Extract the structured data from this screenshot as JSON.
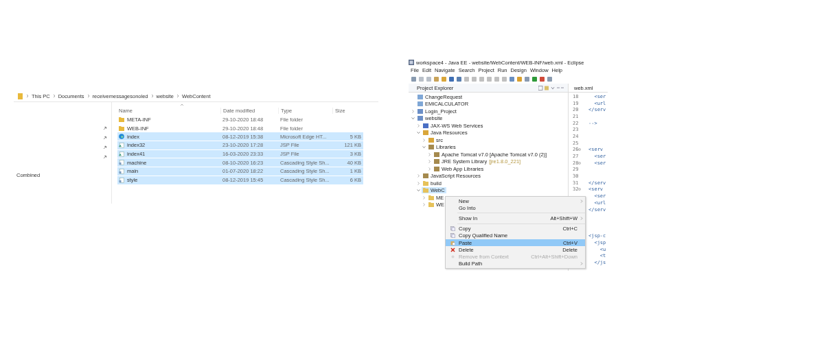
{
  "explorer": {
    "breadcrumb": [
      "This PC",
      "Documents",
      "receivemessagesonoled",
      "website",
      "WebContent"
    ],
    "nav_label": "Combined",
    "columns": [
      "Name",
      "Date modified",
      "Type",
      "Size"
    ],
    "files": [
      {
        "name": "META-INF",
        "kind": "folder",
        "date": "29-10-2020 18:48",
        "type": "File folder",
        "selected": false
      },
      {
        "name": "WEB-INF",
        "kind": "folder",
        "date": "29-10-2020 18:48",
        "type": "File folder",
        "selected": false
      },
      {
        "name": "index",
        "kind": "edge",
        "date": "08-12-2019 15:38",
        "type": "Microsoft Edge HT...",
        "size": "5 KB",
        "selected": true
      },
      {
        "name": "index32",
        "kind": "jsp",
        "date": "23-10-2020 17:28",
        "type": "JSP File",
        "size": "121 KB",
        "selected": true
      },
      {
        "name": "index41",
        "kind": "jsp",
        "date": "16-03-2020 23:33",
        "type": "JSP File",
        "size": "3 KB",
        "selected": true
      },
      {
        "name": "machine",
        "kind": "css",
        "date": "08-10-2020 16:23",
        "type": "Cascading Style Sh...",
        "size": "40 KB",
        "selected": true
      },
      {
        "name": "main",
        "kind": "css",
        "date": "01-07-2020 18:22",
        "type": "Cascading Style Sh...",
        "size": "1 KB",
        "selected": true
      },
      {
        "name": "style",
        "kind": "css",
        "date": "08-12-2019 15:45",
        "type": "Cascading Style Sh...",
        "size": "6 KB",
        "selected": true
      }
    ]
  },
  "eclipse": {
    "title": "workspace4 - Java EE - website/WebContent/WEB-INF/web.xml - Eclipse",
    "menu": [
      "File",
      "Edit",
      "Navigate",
      "Search",
      "Project",
      "Run",
      "Design",
      "Window",
      "Help"
    ],
    "explorer_tab": "Project Explorer",
    "editor_tab": "web.xml",
    "tree": [
      {
        "label": "ChangeRequest",
        "kind": "closed_project",
        "selected": false
      },
      {
        "label": "EMICALCULATOR",
        "kind": "closed_project",
        "selected": false
      },
      {
        "label": "Login_Project",
        "kind": "project",
        "expanded": false,
        "selected": false
      },
      {
        "label": "website",
        "kind": "project",
        "expanded": true,
        "selected": false,
        "children": [
          {
            "label": "JAX-WS Web Services",
            "kind": "services",
            "expanded": false,
            "selected": false
          },
          {
            "label": "Java Resources",
            "kind": "resources",
            "expanded": true,
            "selected": false,
            "children": [
              {
                "label": "src",
                "kind": "source",
                "expanded": false,
                "selected": false
              },
              {
                "label": "Libraries",
                "kind": "library",
                "expanded": true,
                "selected": false,
                "children": [
                  {
                    "label": "Apache Tomcat v7.0 [Apache Tomcat v7.0 (2)]",
                    "kind": "library",
                    "expanded": false,
                    "selected": false
                  },
                  {
                    "label": "JRE System Library",
                    "decoration": "[jre1.8.0_221]",
                    "kind": "library",
                    "expanded": false,
                    "selected": false
                  },
                  {
                    "label": "Web App Libraries",
                    "kind": "library",
                    "expanded": false,
                    "selected": false
                  }
                ]
              }
            ]
          },
          {
            "label": "JavaScript Resources",
            "kind": "library",
            "expanded": false,
            "selected": false
          },
          {
            "label": "build",
            "kind": "folder",
            "expanded": false,
            "selected": false
          },
          {
            "label": "WebC",
            "kind": "folder",
            "expanded": true,
            "selected": true,
            "children": [
              {
                "label": "ME",
                "kind": "folder",
                "expanded": false,
                "selected": false
              },
              {
                "label": "WE",
                "kind": "folder",
                "expanded": false,
                "selected": false
              }
            ]
          }
        ]
      }
    ],
    "code": [
      {
        "number": "18",
        "code": "  <ser"
      },
      {
        "number": "19",
        "code": "  <url"
      },
      {
        "number": "20",
        "code": "</serv"
      },
      {
        "number": "21"
      },
      {
        "number": "22",
        "code": "-->"
      },
      {
        "number": "23"
      },
      {
        "number": "24"
      },
      {
        "number": "25"
      },
      {
        "number": "26",
        "fold": true,
        "code": "<serv"
      },
      {
        "number": "27",
        "code": "  <ser"
      },
      {
        "number": "28",
        "fold": true,
        "code": "  <ser"
      },
      {
        "number": "29"
      },
      {
        "number": "30"
      },
      {
        "number": "31",
        "code": "</serv"
      },
      {
        "number": "32",
        "fold": true,
        "code": "<serv"
      }
    ],
    "code_below_menu": [
      [
        "  <ser",
        "  <url",
        "</serv"
      ],
      [
        "<jsp-c",
        "  <jsp",
        "    <u",
        "    <t",
        "  </js"
      ]
    ],
    "context_menu": [
      {
        "kind": "item",
        "label": "New",
        "submenu": true,
        "selected": false,
        "disabled": false
      },
      {
        "kind": "item",
        "label": "Go Into",
        "submenu": false,
        "selected": false,
        "disabled": false
      },
      {
        "kind": "separator"
      },
      {
        "kind": "item",
        "label": "Show In",
        "shortcut": "Alt+Shift+W",
        "submenu": true,
        "selected": false,
        "disabled": false
      },
      {
        "kind": "separator"
      },
      {
        "kind": "copy",
        "label": "Copy",
        "shortcut": "Ctrl+C",
        "submenu": false,
        "selected": false,
        "disabled": false
      },
      {
        "kind": "copy",
        "label": "Copy Qualified Name",
        "submenu": false,
        "selected": false,
        "disabled": false
      },
      {
        "kind": "paste",
        "label": "Paste",
        "shortcut": "Ctrl+V",
        "submenu": false,
        "selected": true,
        "disabled": false
      },
      {
        "kind": "delete",
        "label": "Delete",
        "shortcut": "Delete",
        "submenu": false,
        "selected": false,
        "disabled": false
      },
      {
        "kind": "remove",
        "label": "Remove from Context",
        "shortcut": "Ctrl+Alt+Shift+Down",
        "submenu": false,
        "selected": false,
        "disabled": true
      },
      {
        "kind": "item",
        "label": "Build Path",
        "submenu": true,
        "selected": false,
        "disabled": false
      }
    ]
  }
}
